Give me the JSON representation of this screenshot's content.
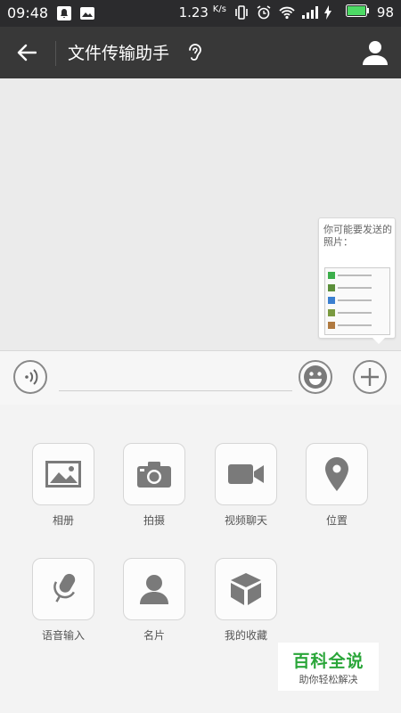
{
  "status_bar": {
    "time": "09:48",
    "speed_value": "1.23",
    "speed_unit": "K/s",
    "battery": "98"
  },
  "header": {
    "title": "文件传输助手",
    "back_icon": "arrow-left-icon",
    "mode_icon": "ear-icon",
    "profile_icon": "user-icon"
  },
  "suggestion": {
    "text": "你可能要发送的照片："
  },
  "input": {
    "value": "",
    "voice_icon": "voice-icon",
    "emoji_icon": "smiley-icon",
    "more_icon": "plus-icon"
  },
  "more_panel": {
    "items": [
      {
        "label": "相册",
        "icon": "picture-icon"
      },
      {
        "label": "拍摄",
        "icon": "camera-icon"
      },
      {
        "label": "视频聊天",
        "icon": "video-camera-icon"
      },
      {
        "label": "位置",
        "icon": "location-pin-icon"
      },
      {
        "label": "语音输入",
        "icon": "microphone-icon"
      },
      {
        "label": "名片",
        "icon": "person-card-icon"
      },
      {
        "label": "我的收藏",
        "icon": "cube-icon"
      }
    ]
  },
  "watermark": {
    "title": "百科全说",
    "subtitle": "助你轻松解决"
  },
  "colors": {
    "header_bg": "#383838",
    "status_bg": "#2b2b2d",
    "battery_green": "#4cd964",
    "watermark_green": "#2aa639",
    "icon_gray": "#7a7a7a"
  }
}
